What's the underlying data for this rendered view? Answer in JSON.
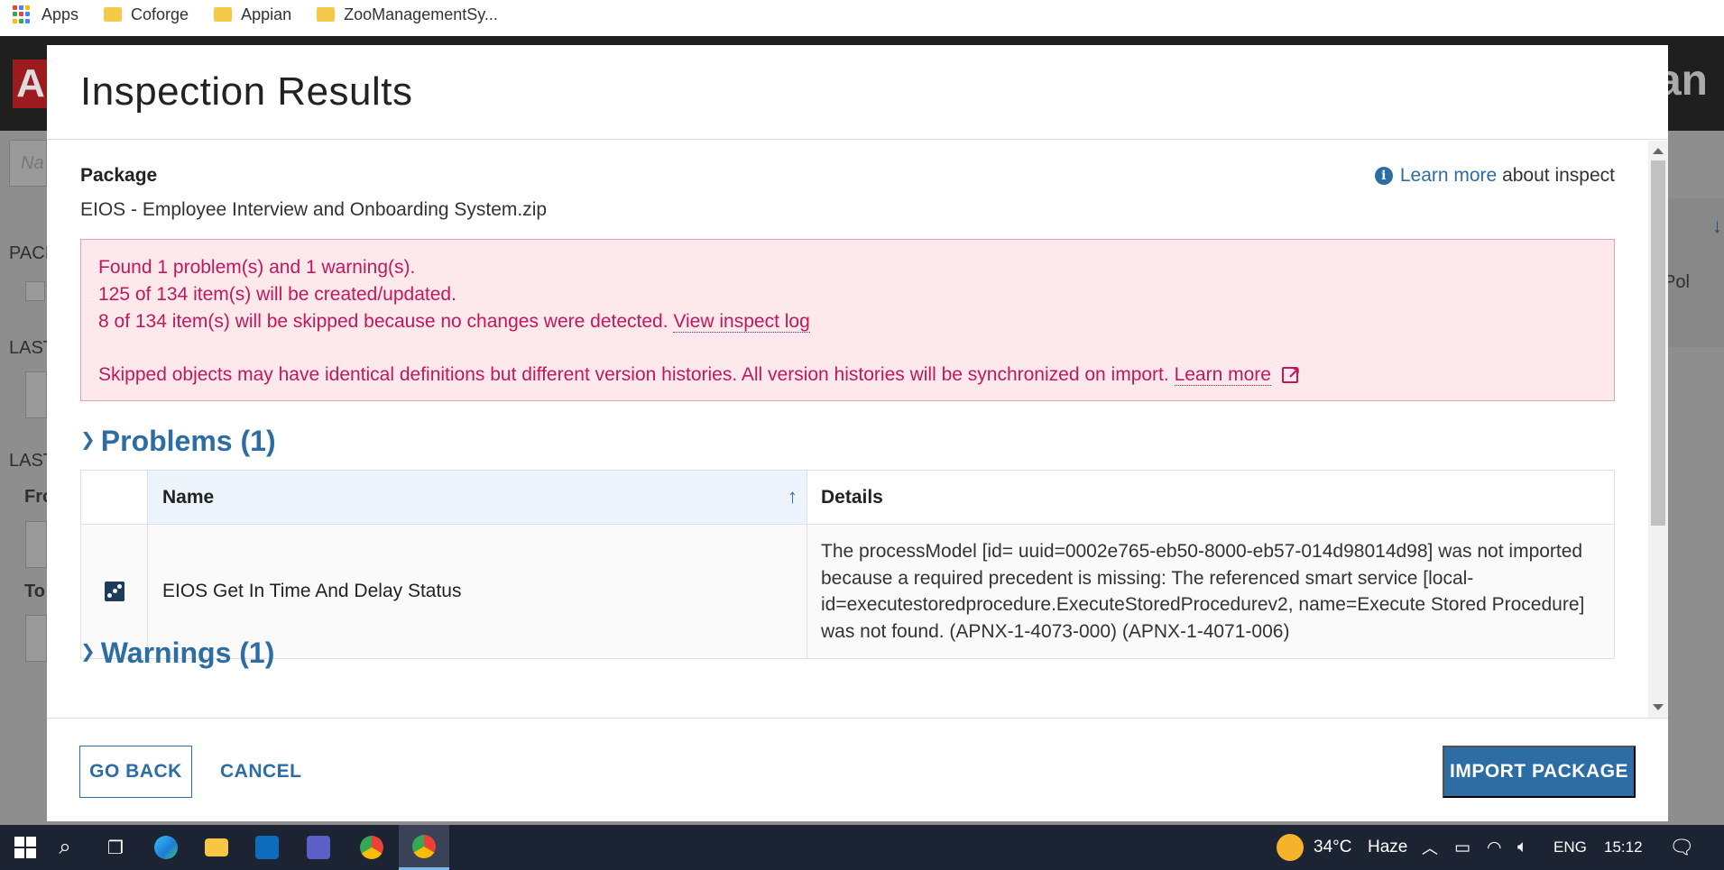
{
  "bookmarks": [
    {
      "label": "Apps",
      "icon": "apps-grid-icon"
    },
    {
      "label": "Coforge",
      "icon": "folder-icon"
    },
    {
      "label": "Appian",
      "icon": "folder-icon"
    },
    {
      "label": "ZooManagementSy...",
      "icon": "folder-icon"
    }
  ],
  "background": {
    "brand_fragment": "an",
    "side_labels": [
      "PACI",
      "LAST",
      "LAST",
      "Fro",
      "To"
    ],
    "search_placeholder": "Na",
    "right_text": "Pol"
  },
  "modal": {
    "title": "Inspection Results",
    "package_label": "Package",
    "package_name": "EIOS - Employee Interview and Onboarding System.zip",
    "learn_more_link": "Learn more",
    "learn_more_suffix": " about inspect",
    "alert": {
      "line1": "Found 1 problem(s) and 1 warning(s).",
      "line2": "125 of 134 item(s) will be created/updated.",
      "line3": "8 of 134 item(s) will be skipped because no changes were detected.",
      "view_log_link": "View inspect log",
      "line4": "Skipped objects may have identical definitions but different version histories. All version histories will be synchronized on import.",
      "learn_more_link": "Learn more",
      "color": "#c2185b",
      "background": "#fde8ec"
    },
    "problems_heading": "Problems (1)",
    "warnings_heading": "Warnings (1)",
    "table": {
      "columns": [
        "Name",
        "Details"
      ],
      "rows": [
        {
          "icon": "process-model-icon",
          "name": "EIOS Get In Time And Delay Status",
          "details": "The processModel [id= uuid=0002e765-eb50-8000-eb57-014d98014d98] was not imported because a required precedent is missing: The referenced smart service [local-id=executestoredprocedure.ExecuteStoredProcedurev2, name=Execute Stored Procedure] was not found. (APNX-1-4073-000) (APNX-1-4071-006)"
        }
      ]
    },
    "buttons": {
      "go_back": "GO BACK",
      "cancel": "CANCEL",
      "import": "IMPORT PACKAGE"
    },
    "accent_color": "#2e6da4"
  },
  "taskbar": {
    "weather_temp": "34°C",
    "weather_desc": "Haze",
    "language": "ENG",
    "time": "15:12"
  }
}
